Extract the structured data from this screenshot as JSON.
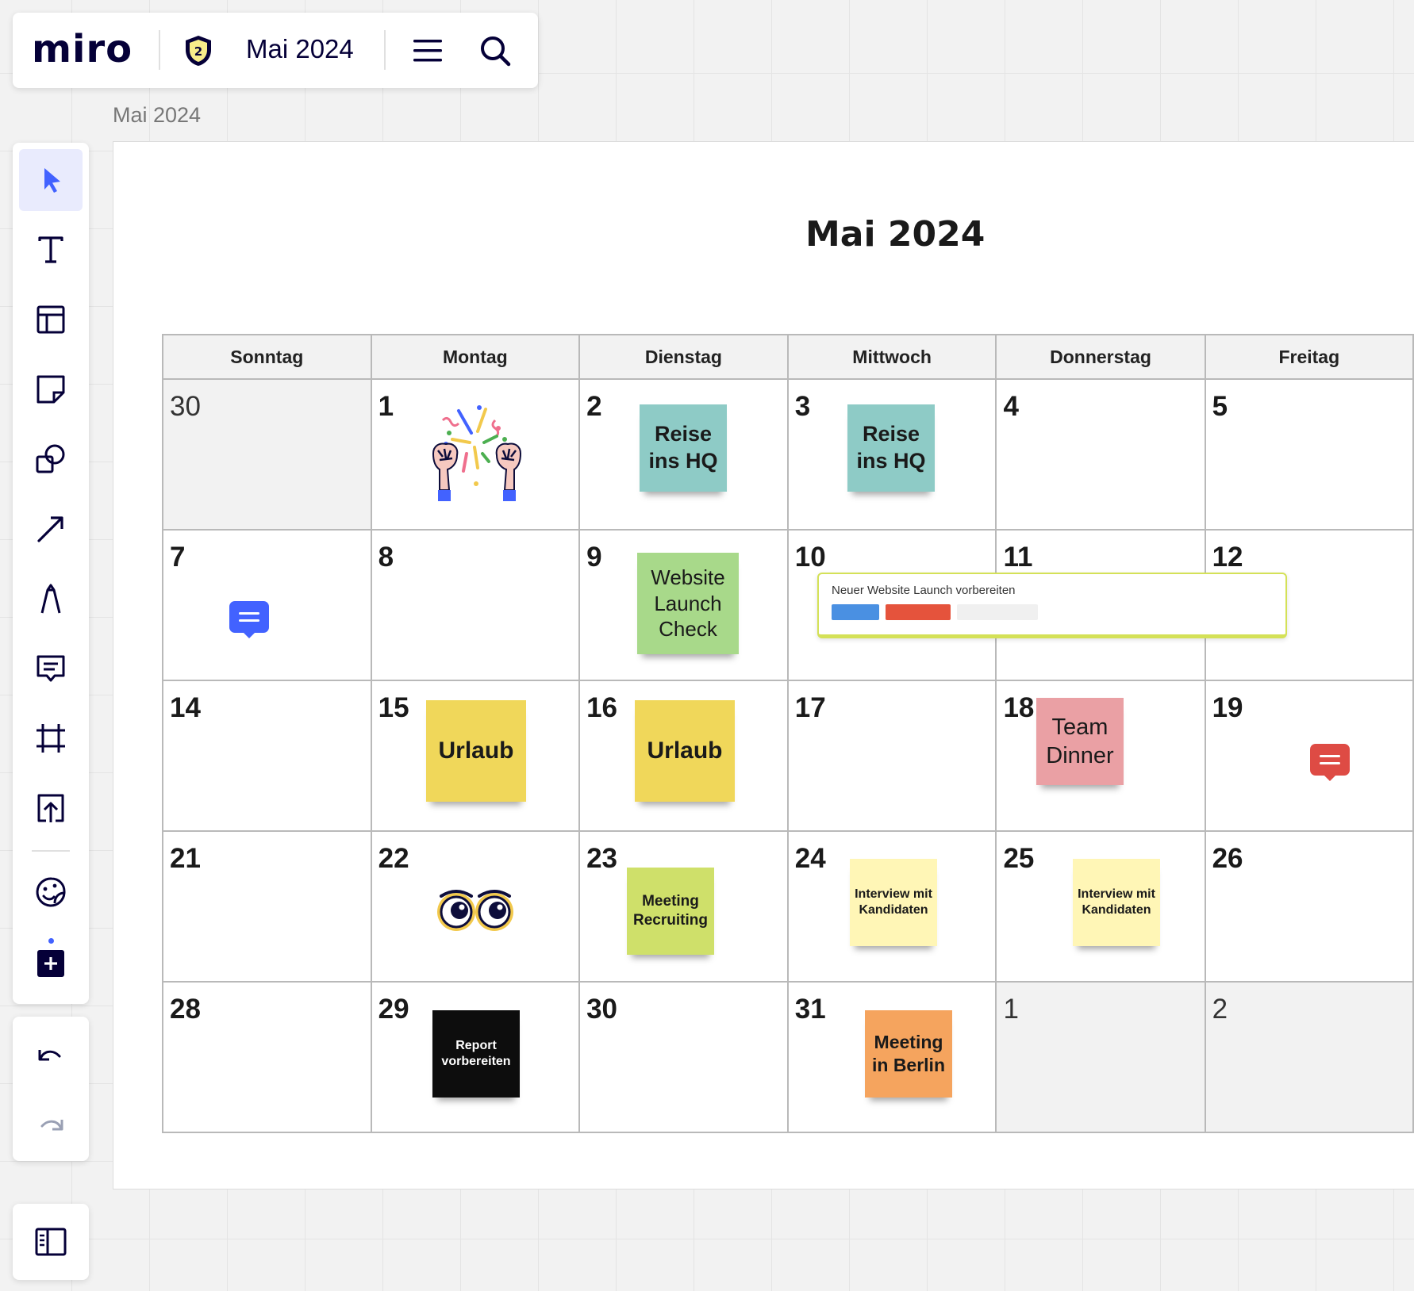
{
  "app": {
    "logo_text": "miro",
    "badge_number": "2",
    "board_title": "Mai 2024",
    "frame_label": "Mai 2024"
  },
  "calendar": {
    "title": "Mai 2024",
    "weekdays": [
      "Sonntag",
      "Montag",
      "Dienstag",
      "Mittwoch",
      "Donnerstag",
      "Freitag"
    ],
    "rows": [
      [
        "30",
        "1",
        "2",
        "3",
        "4",
        "5"
      ],
      [
        "7",
        "8",
        "9",
        "10",
        "11",
        "12"
      ],
      [
        "14",
        "15",
        "16",
        "17",
        "18",
        "19"
      ],
      [
        "21",
        "22",
        "23",
        "24",
        "25",
        "26"
      ],
      [
        "28",
        "29",
        "30",
        "31",
        "1",
        "2"
      ]
    ]
  },
  "stickies": {
    "reise_2": "Reise ins HQ",
    "reise_3": "Reise ins HQ",
    "website_check": "Website Launch Check",
    "urlaub_15": "Urlaub",
    "urlaub_16": "Urlaub",
    "team_dinner": "Team Dinner",
    "meeting_recruiting": "Meeting Recruiting",
    "interview_24": "Interview mit Kandidaten",
    "interview_25": "Interview mit Kandidaten",
    "report": "Report vorbereiten",
    "meeting_berlin": "Meeting in Berlin"
  },
  "card": {
    "title": "Neuer Website Launch vorbereiten"
  },
  "colors": {
    "accent": "#4262ff",
    "sticky_teal": "#8ecbc6",
    "sticky_green": "#a8d98a",
    "sticky_yellow": "#f0d75a",
    "sticky_pink": "#eaa0a4",
    "sticky_lime": "#cfe06a",
    "sticky_lightyellow": "#fff6b6",
    "sticky_black": "#0d0d0d",
    "sticky_orange": "#f5a45e",
    "comment_blue": "#4262ff",
    "comment_red": "#de4b44",
    "card_border": "#d4e157",
    "tag_blue": "#4a90e2",
    "tag_red": "#e5533c"
  },
  "icons": {
    "toolbar": [
      "select-icon",
      "text-icon",
      "templates-icon",
      "sticky-note-icon",
      "shapes-icon",
      "arrow-icon",
      "pen-icon",
      "comment-icon",
      "frame-icon",
      "upload-icon",
      "sticker-icon",
      "more-apps-icon"
    ],
    "history": [
      "undo-icon",
      "redo-icon"
    ],
    "panel": "sidebar-panel-icon"
  }
}
